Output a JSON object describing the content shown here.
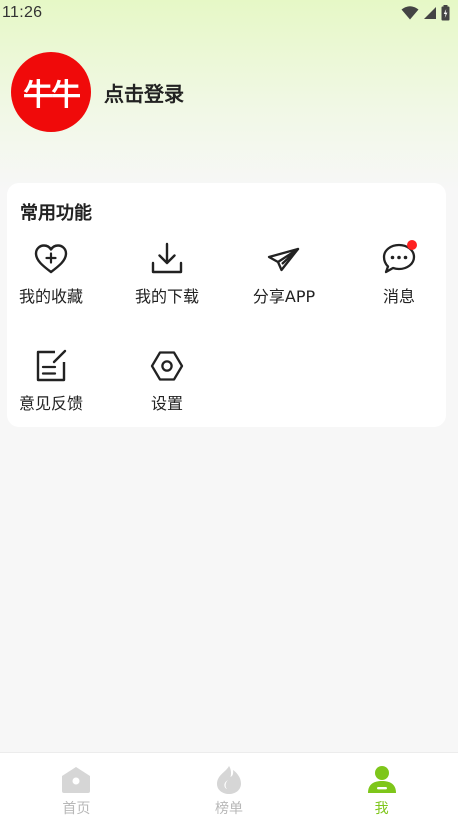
{
  "status_bar": {
    "time": "11:26"
  },
  "profile": {
    "avatar_text": "牛牛",
    "login_label": "点击登录"
  },
  "functions": {
    "title": "常用功能",
    "items": [
      {
        "label": "我的收藏",
        "icon": "heart-plus-icon"
      },
      {
        "label": "我的下载",
        "icon": "download-icon"
      },
      {
        "label": "分享APP",
        "icon": "paper-plane-icon"
      },
      {
        "label": "消息",
        "icon": "chat-bubble-icon",
        "badge": true
      },
      {
        "label": "意见反馈",
        "icon": "feedback-edit-icon"
      },
      {
        "label": "设置",
        "icon": "hexagon-settings-icon"
      }
    ]
  },
  "tabbar": {
    "tabs": [
      {
        "label": "首页",
        "icon": "home-icon",
        "active": false
      },
      {
        "label": "榜单",
        "icon": "flame-icon",
        "active": false
      },
      {
        "label": "我",
        "icon": "user-icon",
        "active": true
      }
    ]
  },
  "colors": {
    "accent": "#7ec61a",
    "avatar_bg": "#f00a0a",
    "badge": "#ff2020",
    "inactive": "#b8b8b8"
  }
}
